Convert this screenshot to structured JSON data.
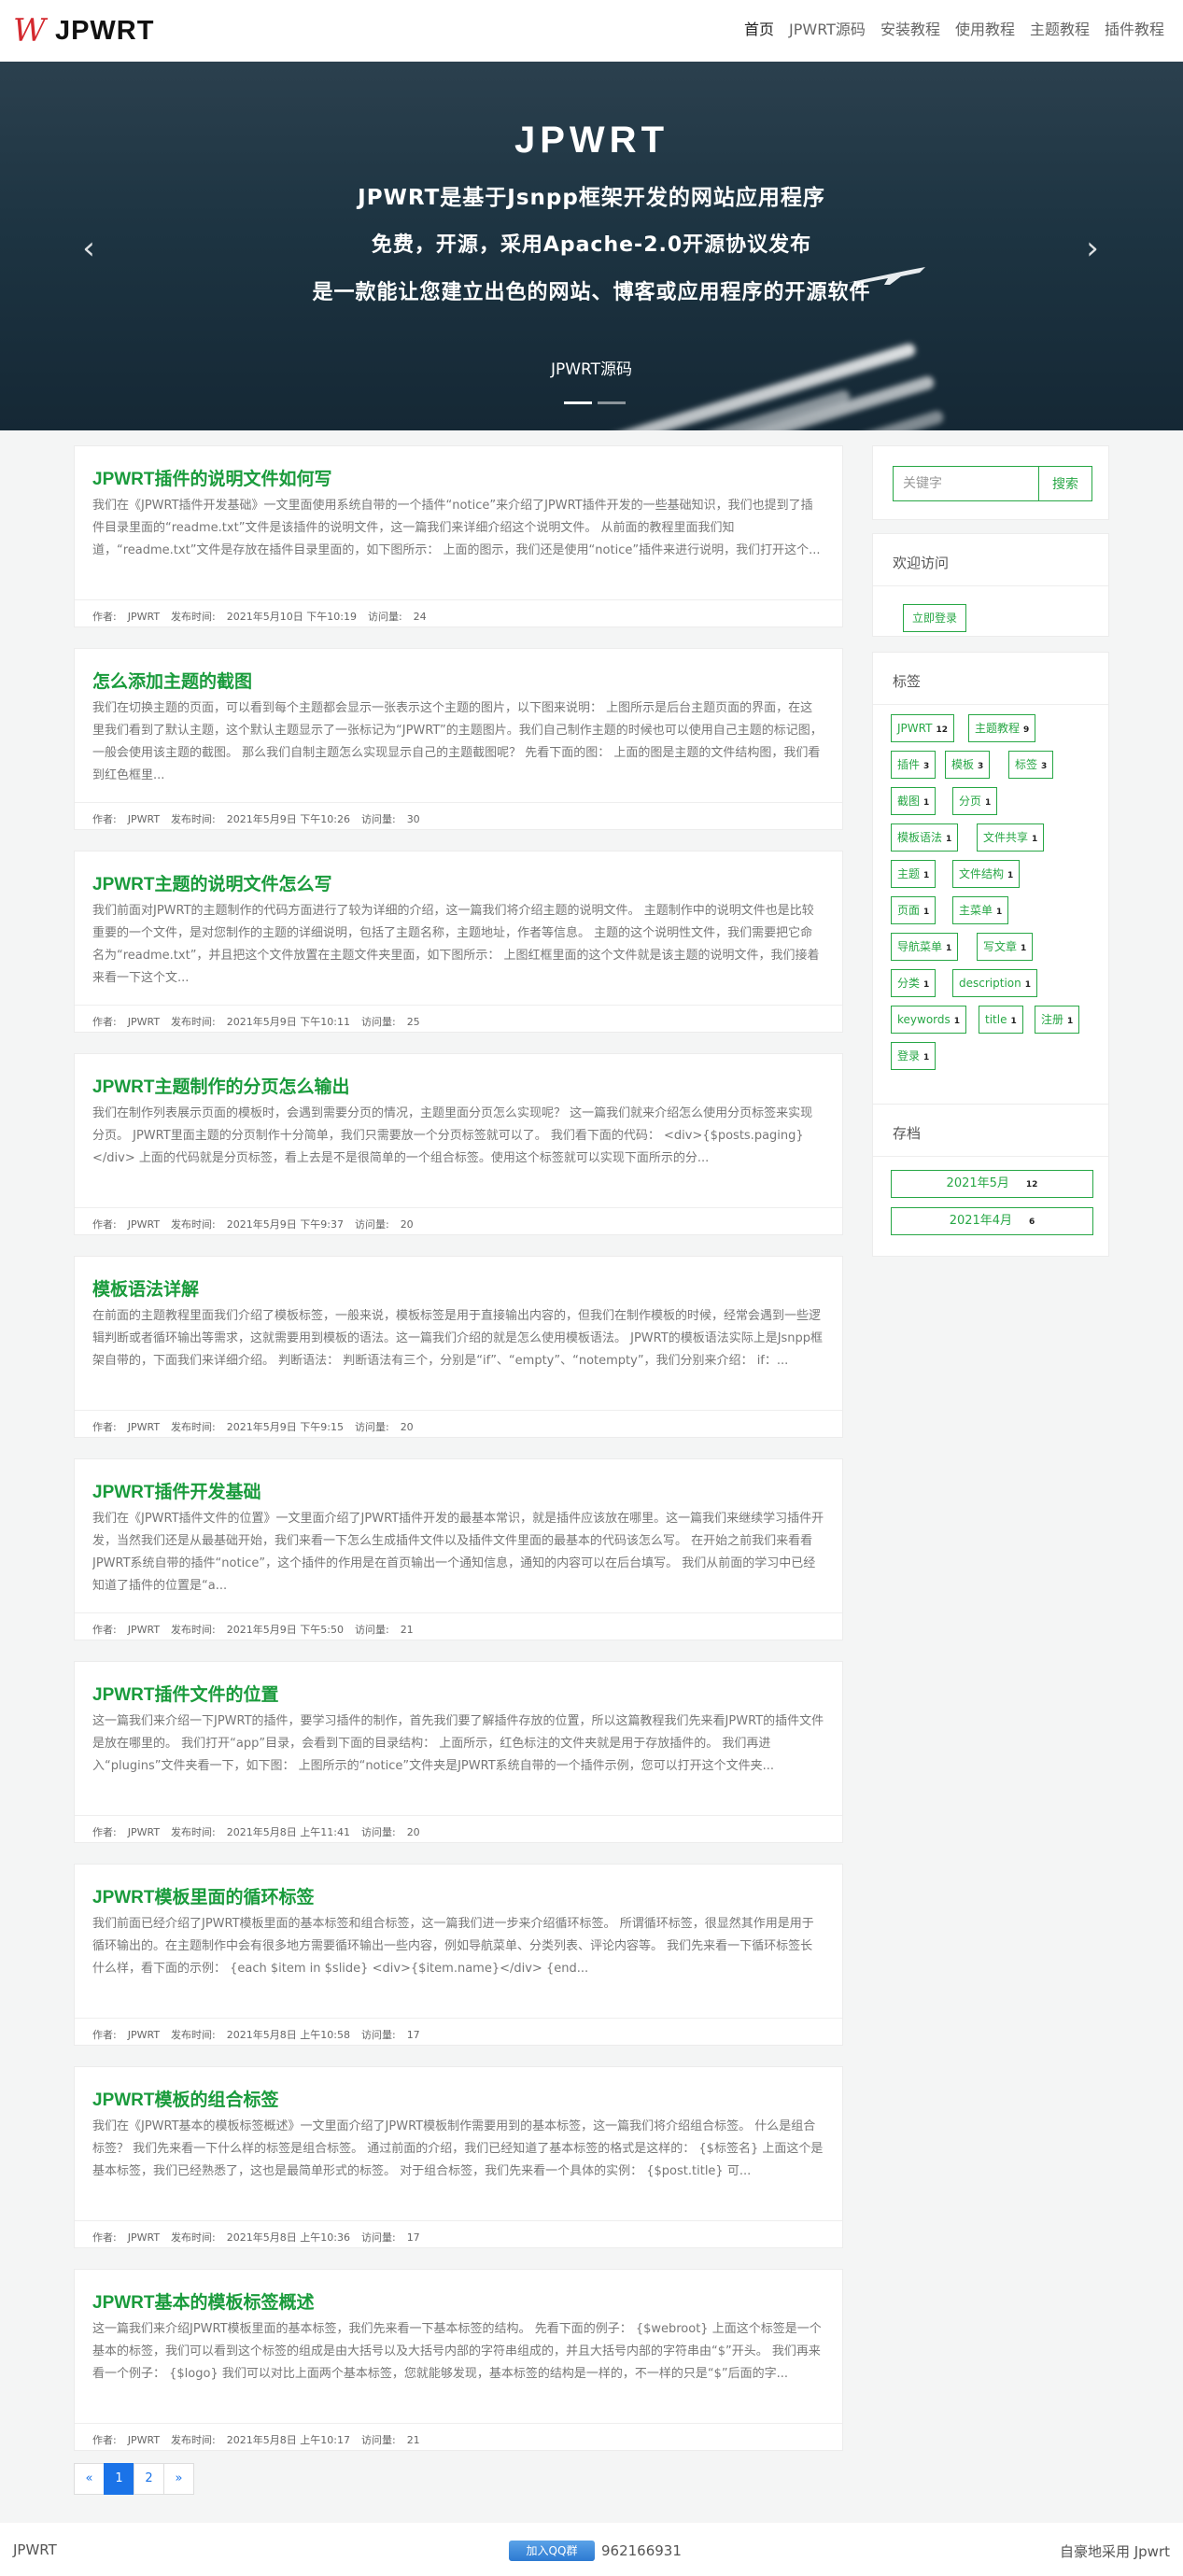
{
  "header": {
    "brand_mark": "W",
    "brand_text": "JPWRT",
    "nav": [
      "首页",
      "JPWRT源码",
      "安装教程",
      "使用教程",
      "主题教程",
      "插件教程"
    ]
  },
  "hero": {
    "title": "JPWRT",
    "line1": "JPWRT是基于Jsnpp框架开发的网站应用程序",
    "line2": "免费，开源，采用Apache-2.0开源协议发布",
    "line3": "是一款能让您建立出色的网站、博客或应用程序的开源软件",
    "caption": "JPWRT源码",
    "prev_arrow": "‹",
    "next_arrow": "›",
    "slide_count": 2,
    "active_slide": 1
  },
  "meta_labels": {
    "author": "作者:",
    "published": "发布时间:",
    "views": "访问量:"
  },
  "articles": [
    {
      "title": "JPWRT插件的说明文件如何写",
      "excerpt": "我们在《JPWRT插件开发基础》一文里面使用系统自带的一个插件“notice”来介绍了JPWRT插件开发的一些基础知识，我们也提到了插件目录里面的“readme.txt”文件是该插件的说明文件，这一篇我们来详细介绍这个说明文件。 从前面的教程里面我们知道，“readme.txt”文件是存放在插件目录里面的，如下图所示： 上面的图示，我们还是使用“notice”插件来进行说明，我们打开这个...",
      "author": "JPWRT",
      "date": "2021年5月10日 下午10:19",
      "views": "24"
    },
    {
      "title": "怎么添加主题的截图",
      "excerpt": "我们在切换主题的页面，可以看到每个主题都会显示一张表示这个主题的图片，以下图来说明： 上图所示是后台主题页面的界面，在这里我们看到了默认主题，这个默认主题显示了一张标记为“JPWRT”的主题图片。我们自己制作主题的时候也可以使用自己主题的标记图，一般会使用该主题的截图。 那么我们自制主题怎么实现显示自己的主题截图呢？ 先看下面的图： 上面的图是主题的文件结构图，我们看到红色框里...",
      "author": "JPWRT",
      "date": "2021年5月9日 下午10:26",
      "views": "30"
    },
    {
      "title": "JPWRT主题的说明文件怎么写",
      "excerpt": "我们前面对JPWRT的主题制作的代码方面进行了较为详细的介绍，这一篇我们将介绍主题的说明文件。 主题制作中的说明文件也是比较重要的一个文件，是对您制作的主题的详细说明，包括了主题名称，主题地址，作者等信息。 主题的这个说明性文件，我们需要把它命名为“readme.txt”，并且把这个文件放置在主题文件夹里面，如下图所示： 上图红框里面的这个文件就是该主题的说明文件，我们接着来看一下这个文...",
      "author": "JPWRT",
      "date": "2021年5月9日 下午10:11",
      "views": "25"
    },
    {
      "title": "JPWRT主题制作的分页怎么输出",
      "excerpt": "我们在制作列表展示页面的模板时，会遇到需要分页的情况，主题里面分页怎么实现呢？ 这一篇我们就来介绍怎么使用分页标签来实现分页。 JPWRT里面主题的分页制作十分简单，我们只需要放一个分页标签就可以了。 我们看下面的代码： <div>{$posts.paging}</div> 上面的代码就是分页标签，看上去是不是很简单的一个组合标签。使用这个标签就可以实现下面所示的分...",
      "author": "JPWRT",
      "date": "2021年5月9日 下午9:37",
      "views": "20"
    },
    {
      "title": "模板语法详解",
      "excerpt": "在前面的主题教程里面我们介绍了模板标签，一般来说，模板标签是用于直接输出内容的，但我们在制作模板的时候，经常会遇到一些逻辑判断或者循环输出等需求，这就需要用到模板的语法。这一篇我们介绍的就是怎么使用模板语法。 JPWRT的模板语法实际上是Jsnpp框架自带的，下面我们来详细介绍。 判断语法： 判断语法有三个，分别是“if”、“empty”、“notempty”，我们分别来介绍： if：...",
      "author": "JPWRT",
      "date": "2021年5月9日 下午9:15",
      "views": "20"
    },
    {
      "title": "JPWRT插件开发基础",
      "excerpt": "我们在《JPWRT插件文件的位置》一文里面介绍了JPWRT插件开发的最基本常识，就是插件应该放在哪里。这一篇我们来继续学习插件开发，当然我们还是从最基础开始，我们来看一下怎么生成插件文件以及插件文件里面的最基本的代码该怎么写。 在开始之前我们来看看JPWRT系统自带的插件“notice”，这个插件的作用是在首页输出一个通知信息，通知的内容可以在后台填写。 我们从前面的学习中已经知道了插件的位置是“a...",
      "author": "JPWRT",
      "date": "2021年5月9日 下午5:50",
      "views": "21"
    },
    {
      "title": "JPWRT插件文件的位置",
      "excerpt": "这一篇我们来介绍一下JPWRT的插件，要学习插件的制作，首先我们要了解插件存放的位置，所以这篇教程我们先来看JPWRT的插件文件是放在哪里的。 我们打开“app”目录，会看到下面的目录结构： 上面所示，红色标注的文件夹就是用于存放插件的。 我们再进入“plugins”文件夹看一下，如下图： 上图所示的“notice”文件夹是JPWRT系统自带的一个插件示例，您可以打开这个文件夹...",
      "author": "JPWRT",
      "date": "2021年5月8日 上午11:41",
      "views": "20"
    },
    {
      "title": "JPWRT模板里面的循环标签",
      "excerpt": "我们前面已经介绍了JPWRT模板里面的基本标签和组合标签，这一篇我们进一步来介绍循环标签。 所谓循环标签，很显然其作用是用于循环输出的。在主题制作中会有很多地方需要循环输出一些内容，例如导航菜单、分类列表、评论内容等。 我们先来看一下循环标签长什么样，看下面的示例： {each $item in $slide} <div>{$item.name}</div> {end...",
      "author": "JPWRT",
      "date": "2021年5月8日 上午10:58",
      "views": "17"
    },
    {
      "title": "JPWRT模板的组合标签",
      "excerpt": "我们在《JPWRT基本的模板标签概述》一文里面介绍了JPWRT模板制作需要用到的基本标签，这一篇我们将介绍组合标签。 什么是组合标签？ 我们先来看一下什么样的标签是组合标签。 通过前面的介绍，我们已经知道了基本标签的格式是这样的： {$标签名} 上面这个是基本标签，我们已经熟悉了，这也是最简单形式的标签。 对于组合标签，我们先来看一个具体的实例： {$post.title} 可...",
      "author": "JPWRT",
      "date": "2021年5月8日 上午10:36",
      "views": "17"
    },
    {
      "title": "JPWRT基本的模板标签概述",
      "excerpt": "这一篇我们来介绍JPWRT模板里面的基本标签，我们先来看一下基本标签的结构。 先看下面的例子： {$webroot} 上面这个标签是一个基本的标签，我们可以看到这个标签的组成是由大括号以及大括号内部的字符串组成的，并且大括号内部的字符串由“$”开头。 我们再来看一个例子： {$logo} 我们可以对比上面两个基本标签，您就能够发现，基本标签的结构是一样的，不一样的只是“$”后面的字...",
      "author": "JPWRT",
      "date": "2021年5月8日 上午10:17",
      "views": "21"
    }
  ],
  "pagination": {
    "prev": "«",
    "pages": [
      "1",
      "2"
    ],
    "current": "1",
    "next": "»"
  },
  "sidebar": {
    "search_placeholder": "关键字",
    "search_button": "搜索",
    "welcome_title": "欢迎访问",
    "login_button": "立即登录",
    "tags_title": "标签",
    "tags": [
      {
        "name": "JPWRT",
        "count": "12"
      },
      {
        "name": "主题教程",
        "count": "9"
      },
      {
        "name": "插件",
        "count": "3"
      },
      {
        "name": "模板",
        "count": "3"
      },
      {
        "name": "标签",
        "count": "3"
      },
      {
        "name": "截图",
        "count": "1"
      },
      {
        "name": "分页",
        "count": "1"
      },
      {
        "name": "模板语法",
        "count": "1"
      },
      {
        "name": "文件共享",
        "count": "1"
      },
      {
        "name": "主题",
        "count": "1"
      },
      {
        "name": "文件结构",
        "count": "1"
      },
      {
        "name": "页面",
        "count": "1"
      },
      {
        "name": "主菜单",
        "count": "1"
      },
      {
        "name": "导航菜单",
        "count": "1"
      },
      {
        "name": "写文章",
        "count": "1"
      },
      {
        "name": "分类",
        "count": "1"
      },
      {
        "name": "description",
        "count": "1"
      },
      {
        "name": "keywords",
        "count": "1"
      },
      {
        "name": "title",
        "count": "1"
      },
      {
        "name": "注册",
        "count": "1"
      },
      {
        "name": "登录",
        "count": "1"
      }
    ],
    "archive_title": "存档",
    "archives": [
      {
        "label": "2021年5月",
        "count": "12"
      },
      {
        "label": "2021年4月",
        "count": "6"
      }
    ]
  },
  "footer": {
    "left": "JPWRT",
    "qq_button": "加入QQ群",
    "qq_number": "962166931",
    "right": "自豪地采用 Jpwrt"
  },
  "colors": {
    "accent": "#1a9b3c",
    "button_green": "#27a745",
    "pager_blue": "#1a73e8"
  }
}
